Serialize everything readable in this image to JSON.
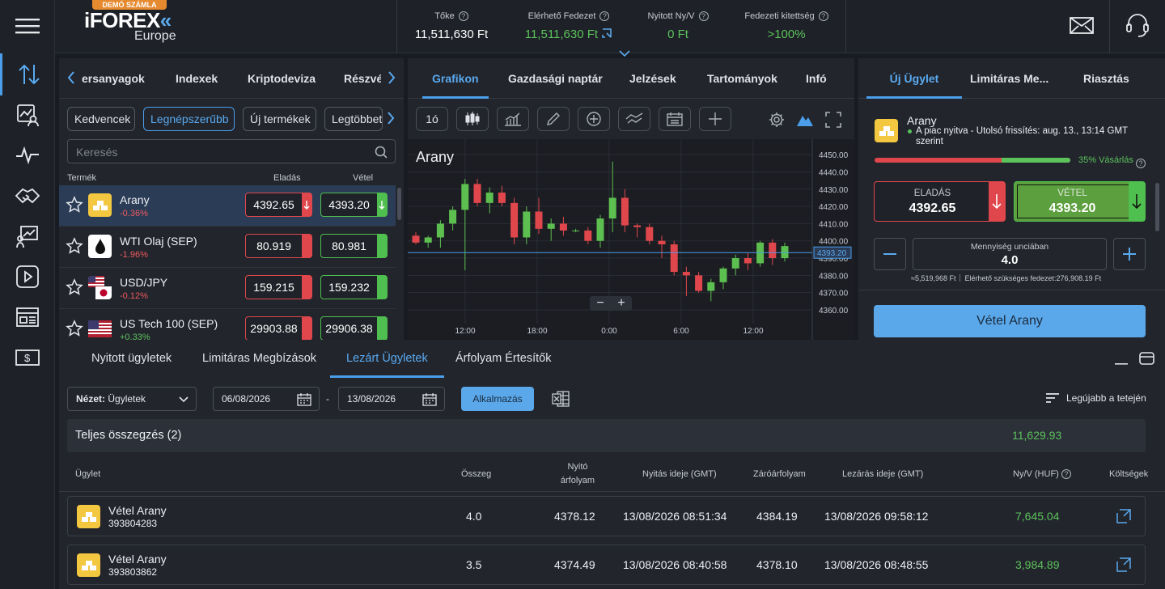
{
  "brand": {
    "badge": "DEMÓ SZÁMLA",
    "logo": "iFOREX",
    "sub": "Europe"
  },
  "stats": [
    {
      "label": "Tőke",
      "value": "11,511,630 Ft",
      "color": "#ffffff"
    },
    {
      "label": "Elérhető Fedezet",
      "value": "11,511,630 Ft",
      "color": "#5cc25c"
    },
    {
      "label": "Nyitott Ny/V",
      "value": "0 Ft",
      "color": "#5cc25c"
    },
    {
      "label": "Fedezeti kitettség",
      "value": ">100%",
      "color": "#5cc25c"
    }
  ],
  "sidebar": {
    "icons": [
      "menu-icon",
      "trade-arrows-icon",
      "portfolio-user-icon",
      "pulse-icon",
      "handshake-icon",
      "analysis-icon",
      "video-play-icon",
      "news-icon",
      "deposit-icon"
    ]
  },
  "market": {
    "tabs": [
      "ersanyagok",
      "Indexek",
      "Kriptodeviza",
      "Részvé"
    ],
    "chips": [
      "Kedvencek",
      "Legnépszerűbb",
      "Új termékek",
      "Legtöbbet"
    ],
    "search_placeholder": "Keresés",
    "col_product": "Termék",
    "col_sell": "Eladás",
    "col_buy": "Vétel",
    "rows": [
      {
        "name": "Arany",
        "change": "-0.36%",
        "dir": "down",
        "sell": "4392.65",
        "buy": "4393.20",
        "icon": "gold-bars-icon"
      },
      {
        "name": "WTI Olaj (SEP)",
        "change": "-1.96%",
        "dir": "down",
        "sell": "80.919",
        "buy": "80.981",
        "icon": "oil-drop-icon"
      },
      {
        "name": "USD/JPY",
        "change": "-0.12%",
        "dir": "down",
        "sell": "159.215",
        "buy": "159.232",
        "icon": "us-japan-flag-icon"
      },
      {
        "name": "US Tech 100 (SEP)",
        "change": "+0.33%",
        "dir": "up",
        "sell": "29903.88",
        "buy": "29906.38",
        "icon": "us-flag-icon"
      }
    ]
  },
  "chart_panel": {
    "tabs": [
      "Grafikon",
      "Gazdasági naptár",
      "Jelzések",
      "Tartományok",
      "Infó"
    ],
    "interval": "1ó",
    "instrument": "Arany"
  },
  "chart_data": {
    "type": "candlestick",
    "title": "Arany",
    "ylim": [
      4352,
      4459
    ],
    "yticks": [
      "4450.00",
      "4440.00",
      "4430.00",
      "4420.00",
      "4410.00",
      "4400.00",
      "4390.00",
      "4380.00",
      "4370.00",
      "4360.00"
    ],
    "xticks": [
      "12:00",
      "18:00",
      "0:00",
      "6:00",
      "12:00"
    ],
    "current_price": "4393.20",
    "candles": [
      {
        "o": 4403,
        "h": 4405,
        "l": 4398,
        "c": 4399
      },
      {
        "o": 4399,
        "h": 4403,
        "l": 4396,
        "c": 4402
      },
      {
        "o": 4402,
        "h": 4412,
        "l": 4396,
        "c": 4410
      },
      {
        "o": 4410,
        "h": 4420,
        "l": 4406,
        "c": 4418
      },
      {
        "o": 4418,
        "h": 4436,
        "l": 4383,
        "c": 4433
      },
      {
        "o": 4433,
        "h": 4436,
        "l": 4420,
        "c": 4422
      },
      {
        "o": 4422,
        "h": 4431,
        "l": 4416,
        "c": 4428
      },
      {
        "o": 4428,
        "h": 4432,
        "l": 4420,
        "c": 4422
      },
      {
        "o": 4422,
        "h": 4425,
        "l": 4398,
        "c": 4402
      },
      {
        "o": 4402,
        "h": 4420,
        "l": 4398,
        "c": 4417
      },
      {
        "o": 4417,
        "h": 4425,
        "l": 4404,
        "c": 4407
      },
      {
        "o": 4407,
        "h": 4413,
        "l": 4400,
        "c": 4410
      },
      {
        "o": 4410,
        "h": 4414,
        "l": 4403,
        "c": 4406
      },
      {
        "o": 4406,
        "h": 4407,
        "l": 4405,
        "c": 4406
      },
      {
        "o": 4406,
        "h": 4408,
        "l": 4398,
        "c": 4400
      },
      {
        "o": 4400,
        "h": 4415,
        "l": 4396,
        "c": 4413
      },
      {
        "o": 4413,
        "h": 4446,
        "l": 4405,
        "c": 4425
      },
      {
        "o": 4425,
        "h": 4430,
        "l": 4405,
        "c": 4409
      },
      {
        "o": 4409,
        "h": 4410,
        "l": 4402,
        "c": 4408
      },
      {
        "o": 4408,
        "h": 4410,
        "l": 4398,
        "c": 4400
      },
      {
        "o": 4400,
        "h": 4403,
        "l": 4390,
        "c": 4398
      },
      {
        "o": 4398,
        "h": 4400,
        "l": 4380,
        "c": 4382
      },
      {
        "o": 4382,
        "h": 4385,
        "l": 4368,
        "c": 4380
      },
      {
        "o": 4380,
        "h": 4382,
        "l": 4370,
        "c": 4371
      },
      {
        "o": 4371,
        "h": 4378,
        "l": 4365,
        "c": 4376
      },
      {
        "o": 4376,
        "h": 4385,
        "l": 4372,
        "c": 4384
      },
      {
        "o": 4384,
        "h": 4392,
        "l": 4380,
        "c": 4390
      },
      {
        "o": 4390,
        "h": 4393,
        "l": 4383,
        "c": 4387
      },
      {
        "o": 4387,
        "h": 4400,
        "l": 4385,
        "c": 4399
      },
      {
        "o": 4399,
        "h": 4401,
        "l": 4386,
        "c": 4390
      },
      {
        "o": 4390,
        "h": 4399,
        "l": 4388,
        "c": 4397
      }
    ]
  },
  "ticket": {
    "tabs": [
      "Új Ügylet",
      "Limitáras Me...",
      "Riasztás"
    ],
    "instrument": "Arany",
    "status": "A piac nyitva - Utolsó frissítés: aug. 13., 13:14 GMT szerint",
    "sentiment_label": "35% Vásárlás",
    "sentiment_buy_pct": 35,
    "sell_label": "ELADÁS",
    "sell_price": "4392.65",
    "buy_label": "VÉTEL",
    "buy_price": "4393.20",
    "qty_label": "Mennyiség unciában",
    "qty": "4.0",
    "value_note": "≈5,519,968 Ft",
    "margin_note": "Elérhető szükséges fedezet:276,908.19 Ft",
    "submit": "Vétel Arany"
  },
  "bottom": {
    "tabs": [
      "Nyitott ügyletek",
      "Limitáras Megbízások",
      "Lezárt Ügyletek",
      "Árfolyam Értesítők"
    ],
    "view_label": "Nézet:",
    "view_value": "Ügyletek",
    "date_from": "06/08/2026",
    "date_sep": "-",
    "date_to": "13/08/2026",
    "apply": "Alkalmazás",
    "sort": "Legújabb a tetején",
    "summary_label": "Teljes összegzés",
    "summary_count": "(2)",
    "summary_total": "11,629.93",
    "headers": {
      "trade": "Ügylet",
      "amount": "Összeg",
      "open_rate_1": "Nyitó",
      "open_rate_2": "árfolyam",
      "open_time": "Nyitás ideje (GMT)",
      "close_rate": "Záróárfolyam",
      "close_time": "Lezárás ideje (GMT)",
      "pl": "Ny/V (HUF)",
      "costs": "Költségek"
    },
    "trades": [
      {
        "name": "Vétel Arany",
        "id": "393804283",
        "amount": "4.0",
        "open": "4378.12",
        "open_time": "13/08/2026 08:51:34",
        "close": "4384.19",
        "close_time": "13/08/2026 09:58:12",
        "pl": "7,645.04"
      },
      {
        "name": "Vétel Arany",
        "id": "393803862",
        "amount": "3.5",
        "open": "4374.49",
        "open_time": "13/08/2026 08:40:58",
        "close": "4378.10",
        "close_time": "13/08/2026 08:48:55",
        "pl": "3,984.89"
      }
    ]
  }
}
